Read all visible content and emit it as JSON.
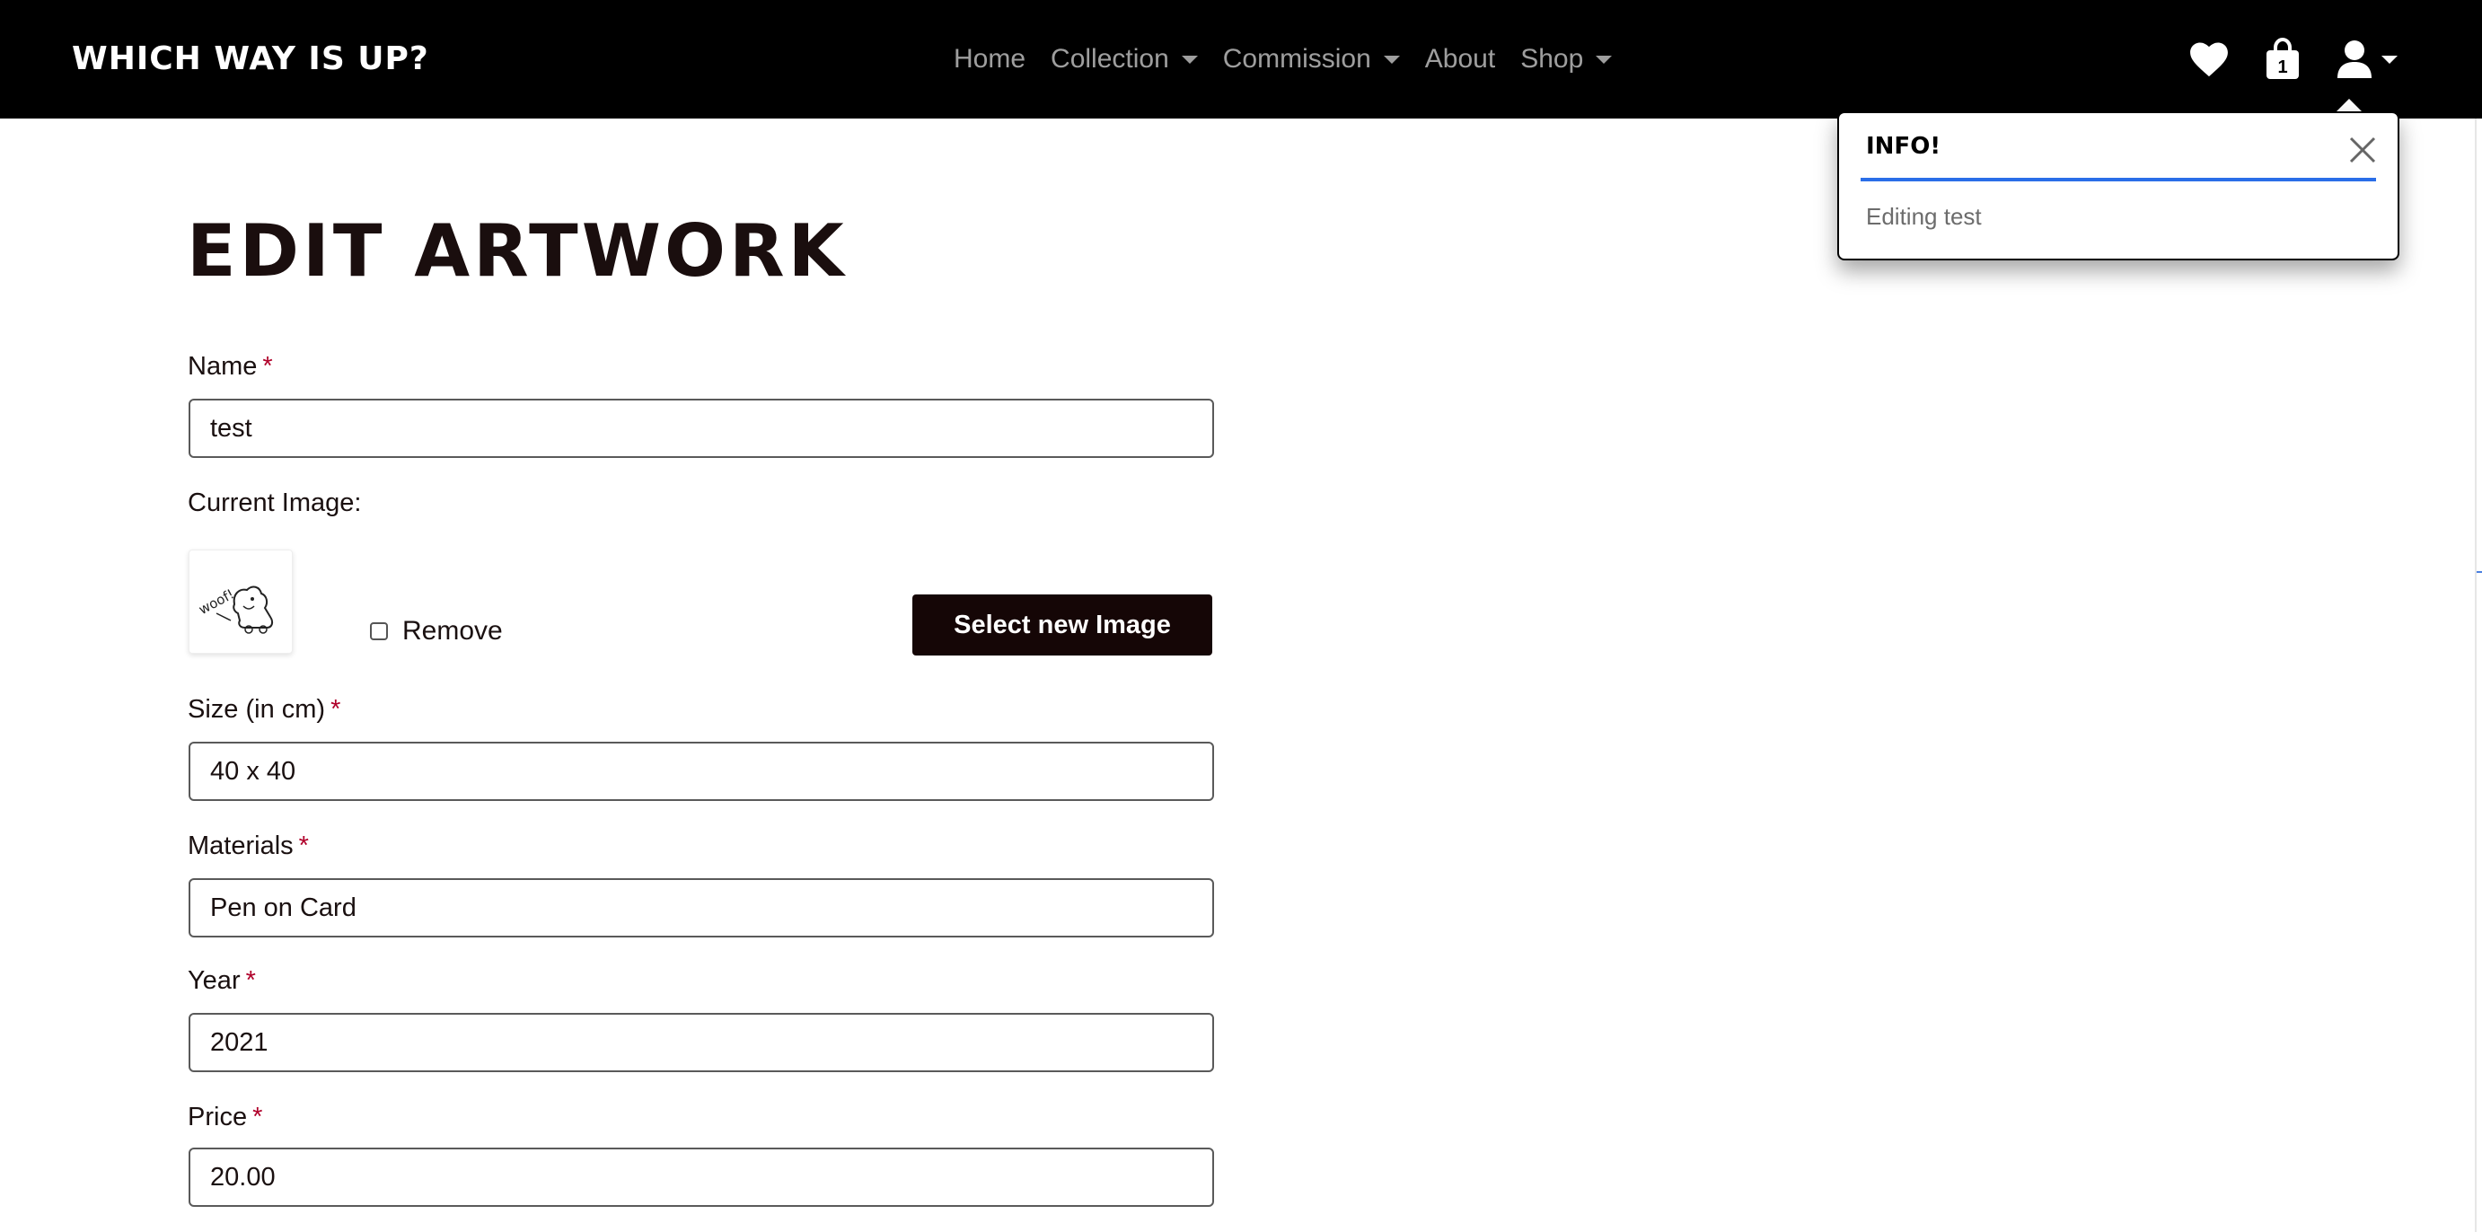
{
  "navbar": {
    "brand": "Which Way Is Up?",
    "links": [
      {
        "label": "Home",
        "dropdown": false
      },
      {
        "label": "Collection",
        "dropdown": true
      },
      {
        "label": "Commission",
        "dropdown": true
      },
      {
        "label": "About",
        "dropdown": false
      },
      {
        "label": "Shop",
        "dropdown": true
      }
    ],
    "icons": {
      "wishlist": "heart-icon",
      "cart": "shopping-bag-icon",
      "cart_count": "1",
      "account": "user-icon"
    }
  },
  "toast": {
    "title": "Info!",
    "message": "Editing test",
    "accent_color": "#2a6ee8"
  },
  "form": {
    "title": "Edit Artwork",
    "required_marker": "*",
    "name": {
      "label": "Name",
      "value": "test"
    },
    "current_image": {
      "label": "Current Image:",
      "thumbnail_text": "woof!",
      "remove_label": "Remove",
      "remove_checked": false,
      "select_button": "Select new Image"
    },
    "size": {
      "label": "Size (in cm)",
      "value": "40 x 40"
    },
    "materials": {
      "label": "Materials",
      "value": "Pen on Card"
    },
    "year": {
      "label": "Year",
      "value": "2021"
    },
    "price": {
      "label": "Price",
      "value": "20.00"
    }
  },
  "colors": {
    "navbar_bg": "#000000",
    "button_bg": "#150606",
    "required": "#b0002a"
  }
}
